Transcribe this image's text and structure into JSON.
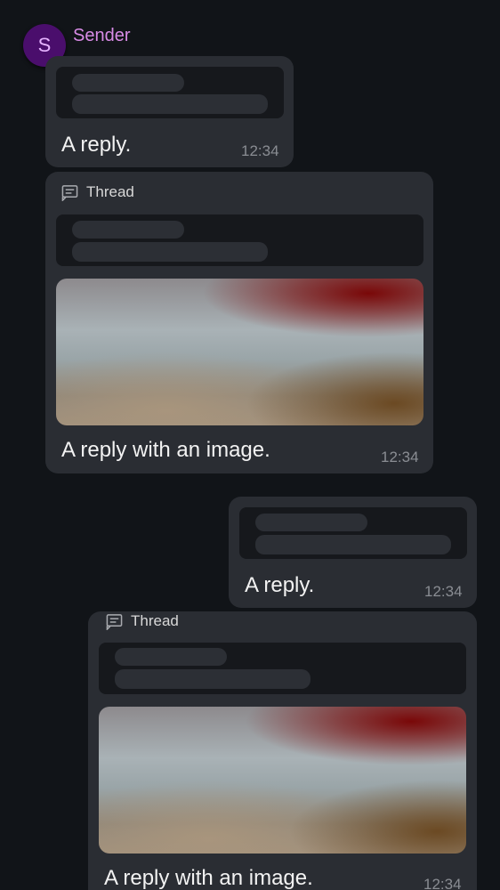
{
  "sender": {
    "initial": "S",
    "name": "Sender"
  },
  "messages": [
    {
      "kind": "reply",
      "text": "A reply.",
      "time": "12:34"
    },
    {
      "kind": "thread-reply-image",
      "thread_label": "Thread",
      "text": "A reply with an image.",
      "time": "12:34"
    },
    {
      "kind": "reply",
      "text": "A reply.",
      "time": "12:34"
    },
    {
      "kind": "thread-reply-image",
      "thread_label": "Thread",
      "text": "A reply with an image.",
      "time": "12:34"
    }
  ],
  "icons": {
    "thread": "thread-icon",
    "avatar": "avatar"
  },
  "colors": {
    "background": "#111418",
    "bubble": "#2a2d33",
    "quote": "#16181c",
    "sender_name": "#d88be6",
    "avatar_bg": "#4a0e6c"
  }
}
